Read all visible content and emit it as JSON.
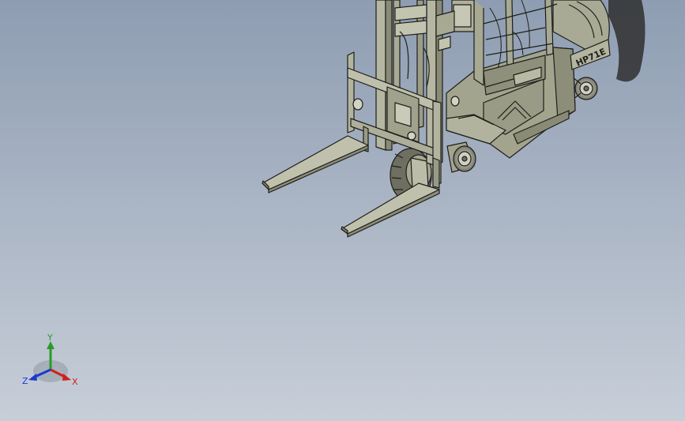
{
  "model": {
    "name_plate": "HP71E",
    "description": "forklift-assembly"
  },
  "triad": {
    "x_label": "X",
    "y_label": "Y",
    "z_label": "Z"
  },
  "colors": {
    "background_top": "#8e9db2",
    "background_bottom": "#c5ccd7",
    "body_fill": "#a3a48e",
    "body_dark": "#7c7d68",
    "edge": "#1e1e1a",
    "shadow": "#3a3a3a",
    "x_axis": "#d11f1f",
    "y_axis": "#2a9a2a",
    "z_axis": "#1a3ad0"
  }
}
